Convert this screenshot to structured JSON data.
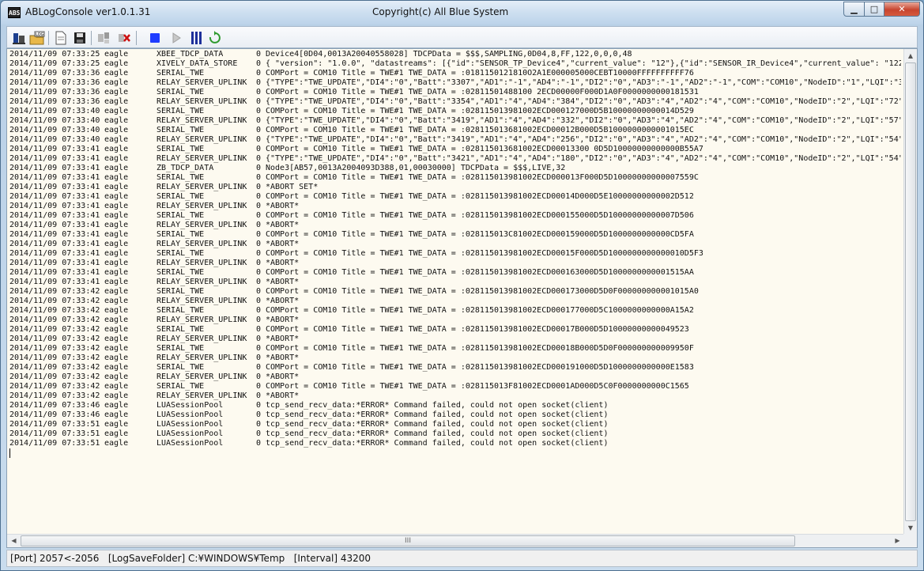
{
  "window": {
    "app_title": "ABLogConsole ver1.0.1.31",
    "copyright": "Copyright(c) All Blue System",
    "icon_text": "ABS"
  },
  "toolbar": {
    "buttons": [
      {
        "name": "tools-icon",
        "glyph": "⚒"
      },
      {
        "name": "open-log-icon",
        "glyph": "LOG"
      },
      {
        "name": "new-document-icon",
        "glyph": "▤"
      },
      {
        "name": "save-icon",
        "glyph": "▦"
      },
      {
        "name": "connect-icon",
        "glyph": "⇆"
      },
      {
        "name": "disconnect-icon",
        "glyph": "✖"
      },
      {
        "name": "stop-icon",
        "glyph": "■"
      },
      {
        "name": "play-icon",
        "glyph": "▶"
      },
      {
        "name": "pause-icon",
        "glyph": "Ⅱ"
      },
      {
        "name": "refresh-icon",
        "glyph": "⟳"
      }
    ]
  },
  "log": {
    "lines": [
      [
        "2014/11/09 07:33:25",
        "eagle",
        "XBEE_TDCP_DATA",
        "0",
        "Device4[0D04,0013A20040558028] TDCPData = $$$,SAMPLING,0D04,8,FF,122,0,0,0,48"
      ],
      [
        "2014/11/09 07:33:25",
        "eagle",
        "XIVELY_DATA_STORE",
        "0",
        "{ \"version\": \"1.0.0\", \"datastreams\": [{\"id\":\"SENSOR_TP_Device4\",\"current_value\": \"12\"},{\"id\":\"SENSOR_IR_Device4\",\"current_value\": \"122\""
      ],
      [
        "2014/11/09 07:33:36",
        "eagle",
        "SERIAL_TWE",
        "0",
        "COMPort = COM10 Title = TWE#1 TWE_DATA = :0181150121810O2A1E000005000CEBT10000FFFFFFFFFF76"
      ],
      [
        "2014/11/09 07:33:36",
        "eagle",
        "RELAY_SERVER_UPLINK",
        "0",
        "{\"TYPE\":\"TWE_UPDATE\",\"DI4\":\"0\",\"Batt\":\"3307\",\"AD1\":\"-1\",\"AD4\":\"-1\",\"DI2\":\"0\",\"AD3\":\"-1\",\"AD2\":\"-1\",\"COM\":\"COM10\",\"NodeID\":\"1\",\"LQI\":\"33"
      ],
      [
        "2014/11/09 07:33:36",
        "eagle",
        "SERIAL_TWE",
        "0",
        "COMPort = COM10 Title = TWE#1 TWE_DATA = :02811501488100 2ECD00000F000D1A0F0000000000181531"
      ],
      [
        "2014/11/09 07:33:36",
        "eagle",
        "RELAY_SERVER_UPLINK",
        "0",
        "{\"TYPE\":\"TWE_UPDATE\",\"DI4\":\"0\",\"Batt\":\"3354\",\"AD1\":\"4\",\"AD4\":\"384\",\"DI2\":\"0\",\"AD3\":\"4\",\"AD2\":\"4\",\"COM\":\"COM10\",\"NodeID\":\"2\",\"LQI\":\"72\""
      ],
      [
        "2014/11/09 07:33:40",
        "eagle",
        "SERIAL_TWE",
        "0",
        "COMPort = COM10 Title = TWE#1 TWE_DATA = :028115013981002ECD000127000D5B10000000000014D529"
      ],
      [
        "2014/11/09 07:33:40",
        "eagle",
        "RELAY_SERVER_UPLINK",
        "0",
        "{\"TYPE\":\"TWE_UPDATE\",\"DI4\":\"0\",\"Batt\":\"3419\",\"AD1\":\"4\",\"AD4\":\"332\",\"DI2\":\"0\",\"AD3\":\"4\",\"AD2\":\"4\",\"COM\":\"COM10\",\"NodeID\":\"2\",\"LQI\":\"57\""
      ],
      [
        "2014/11/09 07:33:40",
        "eagle",
        "SERIAL_TWE",
        "0",
        "COMPort = COM10 Title = TWE#1 TWE_DATA = :028115013681002ECD00012B000D5B1000000000001015EC"
      ],
      [
        "2014/11/09 07:33:40",
        "eagle",
        "RELAY_SERVER_UPLINK",
        "0",
        "{\"TYPE\":\"TWE_UPDATE\",\"DI4\":\"0\",\"Batt\":\"3419\",\"AD1\":\"4\",\"AD4\":\"256\",\"DI2\":\"0\",\"AD3\":\"4\",\"AD2\":\"4\",\"COM\":\"COM10\",\"NodeID\":\"2\",\"LQI\":\"54\""
      ],
      [
        "2014/11/09 07:33:41",
        "eagle",
        "SERIAL_TWE",
        "0",
        "COMPort = COM10 Title = TWE#1 TWE_DATA = :028115013681002ECD00013300 0D5D10000000000000B55A7"
      ],
      [
        "2014/11/09 07:33:41",
        "eagle",
        "RELAY_SERVER_UPLINK",
        "0",
        "{\"TYPE\":\"TWE_UPDATE\",\"DI4\":\"0\",\"Batt\":\"3421\",\"AD1\":\"4\",\"AD4\":\"180\",\"DI2\":\"0\",\"AD3\":\"4\",\"AD2\":\"4\",\"COM\":\"COM10\",\"NodeID\":\"2\",\"LQI\":\"54\""
      ],
      [
        "2014/11/09 07:33:41",
        "eagle",
        "ZB_TDCP_DATA",
        "0",
        "Node3[AB57,0013A2004093D388,01,00030000] TDCPData = $$$,LIVE,32"
      ],
      [
        "2014/11/09 07:33:41",
        "eagle",
        "SERIAL_TWE",
        "0",
        "COMPort = COM10 Title = TWE#1 TWE_DATA = :028115013981002ECD000013F000D5D10000000000007559C"
      ],
      [
        "2014/11/09 07:33:41",
        "eagle",
        "RELAY_SERVER_UPLINK",
        "0",
        "*ABORT SET*"
      ],
      [
        "2014/11/09 07:33:41",
        "eagle",
        "SERIAL_TWE",
        "0",
        "COMPort = COM10 Title = TWE#1 TWE_DATA = :028115013981002ECD00014D000D5E10000000000002D512"
      ],
      [
        "2014/11/09 07:33:41",
        "eagle",
        "RELAY_SERVER_UPLINK",
        "0",
        "*ABORT*"
      ],
      [
        "2014/11/09 07:33:41",
        "eagle",
        "SERIAL_TWE",
        "0",
        "COMPort = COM10 Title = TWE#1 TWE_DATA = :028115013981002ECD000155000D5D10000000000007D506"
      ],
      [
        "2014/11/09 07:33:41",
        "eagle",
        "RELAY_SERVER_UPLINK",
        "0",
        "*ABORT*"
      ],
      [
        "2014/11/09 07:33:41",
        "eagle",
        "SERIAL_TWE",
        "0",
        "COMPort = COM10 Title = TWE#1 TWE_DATA = :028115013C81002ECD000159000D5D1000000000000CD5FA"
      ],
      [
        "2014/11/09 07:33:41",
        "eagle",
        "RELAY_SERVER_UPLINK",
        "0",
        "*ABORT*"
      ],
      [
        "2014/11/09 07:33:41",
        "eagle",
        "SERIAL_TWE",
        "0",
        "COMPort = COM10 Title = TWE#1 TWE_DATA = :028115013981002ECD00015F000D5D1000000000000010D5F3"
      ],
      [
        "2014/11/09 07:33:41",
        "eagle",
        "RELAY_SERVER_UPLINK",
        "0",
        "*ABORT*"
      ],
      [
        "2014/11/09 07:33:41",
        "eagle",
        "SERIAL_TWE",
        "0",
        "COMPort = COM10 Title = TWE#1 TWE_DATA = :028115013981002ECD000163000D5D1000000000001515AA"
      ],
      [
        "2014/11/09 07:33:41",
        "eagle",
        "RELAY_SERVER_UPLINK",
        "0",
        "*ABORT*"
      ],
      [
        "2014/11/09 07:33:42",
        "eagle",
        "SERIAL_TWE",
        "0",
        "COMPort = COM10 Title = TWE#1 TWE_DATA = :028115013981002ECD000173000D5D0F000000000001015A0"
      ],
      [
        "2014/11/09 07:33:42",
        "eagle",
        "RELAY_SERVER_UPLINK",
        "0",
        "*ABORT*"
      ],
      [
        "2014/11/09 07:33:42",
        "eagle",
        "SERIAL_TWE",
        "0",
        "COMPort = COM10 Title = TWE#1 TWE_DATA = :028115013981002ECD000177000D5C1000000000000A15A2"
      ],
      [
        "2014/11/09 07:33:42",
        "eagle",
        "RELAY_SERVER_UPLINK",
        "0",
        "*ABORT*"
      ],
      [
        "2014/11/09 07:33:42",
        "eagle",
        "SERIAL_TWE",
        "0",
        "COMPort = COM10 Title = TWE#1 TWE_DATA = :028115013981002ECD00017B000D5D10000000000049523"
      ],
      [
        "2014/11/09 07:33:42",
        "eagle",
        "RELAY_SERVER_UPLINK",
        "0",
        "*ABORT*"
      ],
      [
        "2014/11/09 07:33:42",
        "eagle",
        "SERIAL_TWE",
        "0",
        "COMPort = COM10 Title = TWE#1 TWE_DATA = :028115013981002ECD00018B000D5D0F000000000009950F"
      ],
      [
        "2014/11/09 07:33:42",
        "eagle",
        "RELAY_SERVER_UPLINK",
        "0",
        "*ABORT*"
      ],
      [
        "2014/11/09 07:33:42",
        "eagle",
        "SERIAL_TWE",
        "0",
        "COMPort = COM10 Title = TWE#1 TWE_DATA = :028115013981002ECD000191000D5D1000000000000E1583"
      ],
      [
        "2014/11/09 07:33:42",
        "eagle",
        "RELAY_SERVER_UPLINK",
        "0",
        "*ABORT*"
      ],
      [
        "2014/11/09 07:33:42",
        "eagle",
        "SERIAL_TWE",
        "0",
        "COMPort = COM10 Title = TWE#1 TWE_DATA = :028115013F81002ECD0001AD000D5C0F0000000000C1565"
      ],
      [
        "2014/11/09 07:33:42",
        "eagle",
        "RELAY_SERVER_UPLINK",
        "0",
        "*ABORT*"
      ],
      [
        "2014/11/09 07:33:46",
        "eagle",
        "LUASessionPool",
        "0",
        "tcp_send_recv_data:*ERROR* Command failed, could not open socket(client)"
      ],
      [
        "2014/11/09 07:33:46",
        "eagle",
        "LUASessionPool",
        "0",
        "tcp_send_recv_data:*ERROR* Command failed, could not open socket(client)"
      ],
      [
        "2014/11/09 07:33:51",
        "eagle",
        "LUASessionPool",
        "0",
        "tcp_send_recv_data:*ERROR* Command failed, could not open socket(client)"
      ],
      [
        "2014/11/09 07:33:51",
        "eagle",
        "LUASessionPool",
        "0",
        "tcp_send_recv_data:*ERROR* Command failed, could not open socket(client)"
      ],
      [
        "2014/11/09 07:33:51",
        "eagle",
        "LUASessionPool",
        "0",
        "tcp_send_recv_data:*ERROR* Command failed, could not open socket(client)"
      ]
    ]
  },
  "hscroll": {
    "grip": "III"
  },
  "status": {
    "text": "[Port] 2057<-2056   [LogSaveFolder] C:¥WINDOWS¥Temp   [Interval] 43200"
  },
  "colors": {
    "stop": "#1e3cff",
    "pause": "#1d2f9a",
    "refresh": "#2e9a2e",
    "disconnect": "#cc1111"
  }
}
